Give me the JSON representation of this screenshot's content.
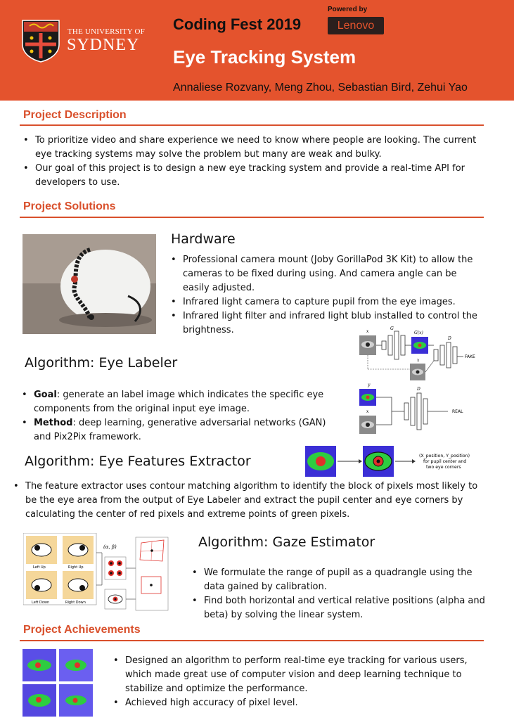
{
  "header": {
    "university_line1": "THE UNIVERSITY OF",
    "university_line2": "SYDNEY",
    "fest_title": "Coding Fest 2019",
    "powered_by": "Powered by",
    "sponsor": "Lenovo",
    "title": "Eye Tracking System",
    "authors": "Annaliese Rozvany, Meng Zhou, Sebastian Bird, Zehui Yao"
  },
  "colors": {
    "header_bg": "#e4532d",
    "section_heading": "#d9502c",
    "label_green": "#2ecc40",
    "label_red": "#e0302a",
    "label_blue": "#3b2fd6"
  },
  "description": {
    "heading": "Project Description",
    "items": [
      "To prioritize video and share experience we need to know where people are looking. The current eye tracking systems may solve the problem but many are weak and bulky.",
      "Our goal of this project is to design a new eye tracking system and provide a real-time API for developers to use."
    ]
  },
  "solutions": {
    "heading": "Project Solutions",
    "hardware": {
      "title": "Hardware",
      "items": [
        "Professional camera mount (Joby GorillaPod 3K Kit) to allow the cameras to be fixed during using. And camera angle can be easily adjusted.",
        "Infrared light camera to capture pupil from the eye images.",
        "Infrared light filter and infrared light blub installed to control the brightness."
      ]
    },
    "labeler": {
      "title": "Algorithm: Eye Labeler",
      "goal_label": "Goal",
      "goal_text": ": generate an label image which indicates the specific eye components from the original input eye image.",
      "method_label": "Method",
      "method_text": ": deep learning, generative adversarial networks (GAN) and Pix2Pix framework.",
      "diagram": {
        "x": "x",
        "G": "G",
        "Gx": "G(x)",
        "D": "D",
        "fake": "FAKE",
        "y": "y",
        "real": "REAL"
      }
    },
    "extractor": {
      "title": "Algorithm: Eye Features Extractor",
      "text": "The feature extractor uses contour matching algorithm to identify the block of pixels most likely to be the eye area from the output of Eye Labeler and extract the pupil center and eye corners by calculating the center of red pixels and extreme points of green pixels.",
      "output_line1": "(X_position, Y_position)",
      "output_line2": "for pupil center and",
      "output_line3": "two eye corners"
    },
    "gaze": {
      "title": "Algorithm: Gaze Estimator",
      "items": [
        "We formulate the range of pupil as a quadrangle using the data gained by calibration.",
        "Find both horizontal and vertical relative positions (alpha and beta) by solving the linear system."
      ],
      "diagram": {
        "left_up": "Left Up",
        "right_up": "Right Up",
        "left_down": "Left Down",
        "right_down": "Right Down",
        "alpha_beta": "(α, β)"
      }
    }
  },
  "achievements": {
    "heading": "Project Achievements",
    "items": [
      "Designed an algorithm to perform real-time eye tracking for various users, which made great use of computer vision and deep learning technique to stabilize and optimize the performance.",
      "Achieved high accuracy of pixel level."
    ]
  }
}
